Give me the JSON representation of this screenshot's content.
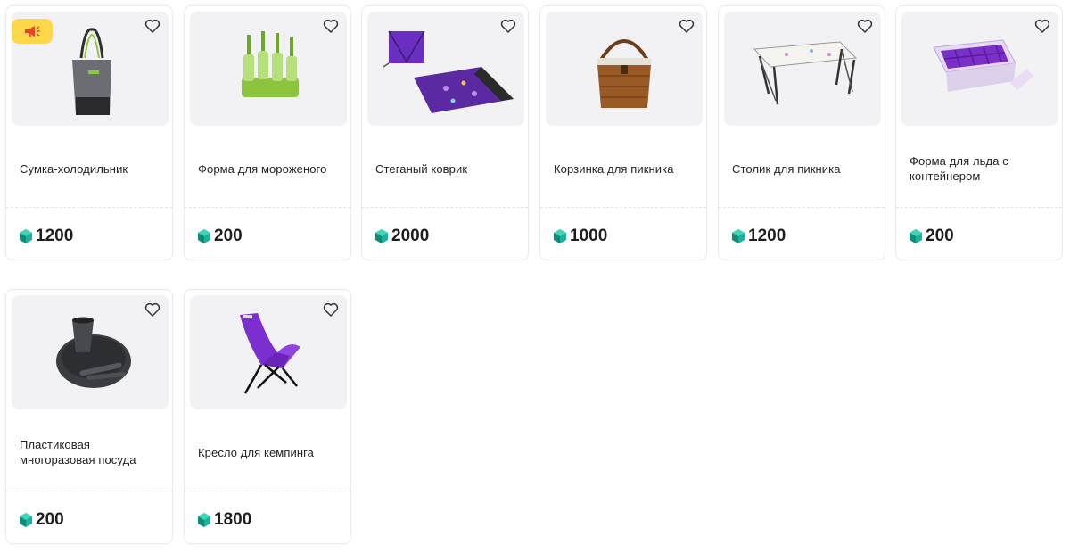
{
  "products": [
    {
      "title": "Сумка-холодильник",
      "price": "1200",
      "image_icon": "cooler-bag-icon",
      "promo_icon": "megaphone-icon"
    },
    {
      "title": "Форма для мороженого",
      "price": "200",
      "image_icon": "popsicle-mold-icon"
    },
    {
      "title": "Стеганый коврик",
      "price": "2000",
      "image_icon": "picnic-blanket-icon"
    },
    {
      "title": "Корзинка для пикника",
      "price": "1000",
      "image_icon": "picnic-basket-icon"
    },
    {
      "title": "Столик для пикника",
      "price": "1200",
      "image_icon": "folding-table-icon"
    },
    {
      "title": "Форма для льда с контейнером",
      "price": "200",
      "image_icon": "ice-tray-icon"
    },
    {
      "title": "Пластиковая многоразовая посуда",
      "price": "200",
      "image_icon": "tableware-set-icon"
    },
    {
      "title": "Кресло для кемпинга",
      "price": "1800",
      "image_icon": "camping-chair-icon"
    }
  ],
  "colors": {
    "promo_badge": "#ffd84a",
    "promo_icon": "#e8432a",
    "currency_gem": "#18b39a",
    "image_bg": "#f2f2f5",
    "accent_purple": "#7b2fd0"
  },
  "icons": {
    "favorite": "heart-outline-icon",
    "currency": "gem-coin-icon"
  }
}
